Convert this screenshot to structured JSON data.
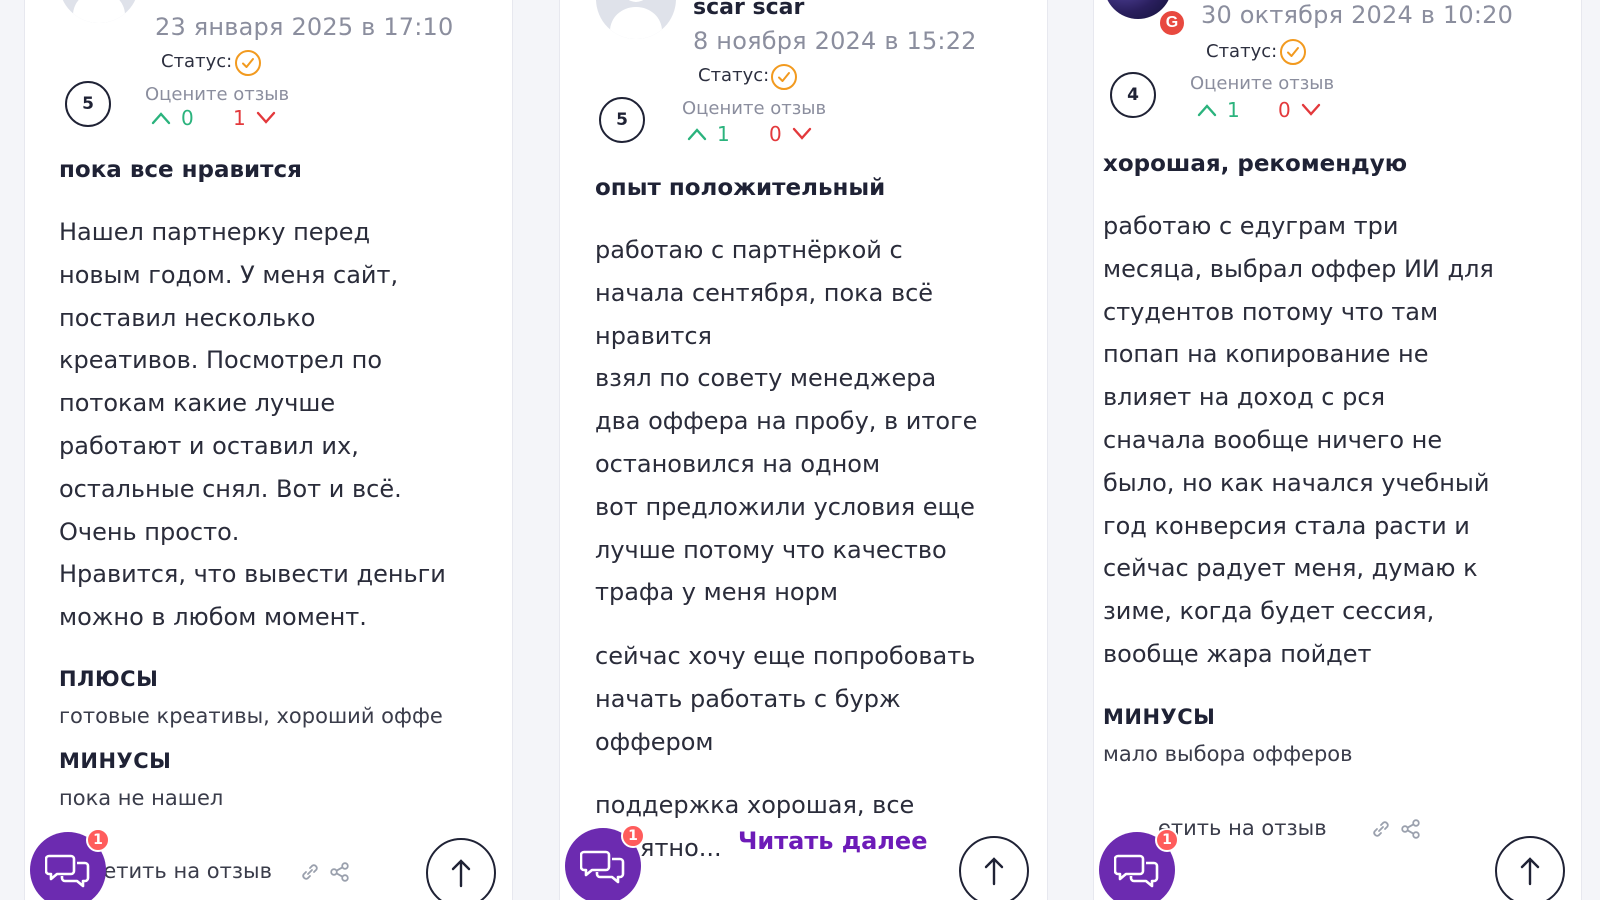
{
  "reviews": [
    {
      "author": "",
      "date": "23 января 2025 в 17:10",
      "status_label": "Статус:",
      "rating": "5",
      "rate_label": "Оцените отзыв",
      "votes_up": "0",
      "votes_down": "1",
      "title": "пока все нравится",
      "body": [
        "Нашел партнерку перед",
        "новым годом. У меня сайт,",
        "поставил несколько",
        "креативов. Посмотрел по",
        "потокам какие лучше",
        "работают и оставил их,",
        "остальные снял. Вот и всё.",
        "Очень просто.",
        "Нравится, что вывести деньги",
        "можно в любом момент."
      ],
      "pros_label": "ПЛЮСЫ",
      "pros": "готовые креативы, хороший оффе",
      "cons_label": "МИНУСЫ",
      "cons": "пока не нашел",
      "reply_label": "ветить на отзыв"
    },
    {
      "author": "scar scar",
      "date": "8 ноября 2024 в 15:22",
      "status_label": "Статус:",
      "rating": "5",
      "rate_label": "Оцените отзыв",
      "votes_up": "1",
      "votes_down": "0",
      "title": "опыт положительный",
      "body": [
        "работаю с партнёркой с",
        "начала сентября, пока всё",
        "нравится",
        "взял по совету менеджера",
        "два оффера на пробу, в итоге",
        "остановился на одном",
        "вот предложили условия еще",
        "лучше потому что качество",
        "трафа у меня норм"
      ],
      "body2": [
        "сейчас хочу еще попробовать",
        "начать работать с бурж",
        "оффером"
      ],
      "body3_line1": "поддержка хорошая, все",
      "body3_line2": "ятно...",
      "read_more": "Читать далее"
    },
    {
      "author": "",
      "date": "30 октября 2024 в 10:20",
      "avatar_badge": "G",
      "status_label": "Статус:",
      "rating": "4",
      "rate_label": "Оцените отзыв",
      "votes_up": "1",
      "votes_down": "0",
      "title": "хорошая, рекомендую",
      "body": [
        "работаю с едуграм три",
        "месяца, выбрал оффер ИИ для",
        "студентов потому что там",
        "попап на копирование не",
        "влияет на доход с рся",
        "сначала вообще ничего не",
        "было, но как начался учебный",
        "год конверсия стала расти и",
        "сейчас радует меня, думаю к",
        "зиме, когда будет сессия,",
        "вообще жара пойдет"
      ],
      "cons_label": "МИНУСЫ",
      "cons": "мало выбора офферов",
      "reply_label": "етить на отзыв"
    }
  ],
  "chat_badge_count": "1",
  "colors": {
    "accent": "#6d1bb8",
    "vote_up": "#2bb37d",
    "vote_down": "#e3393c",
    "status": "#f29a1f"
  }
}
